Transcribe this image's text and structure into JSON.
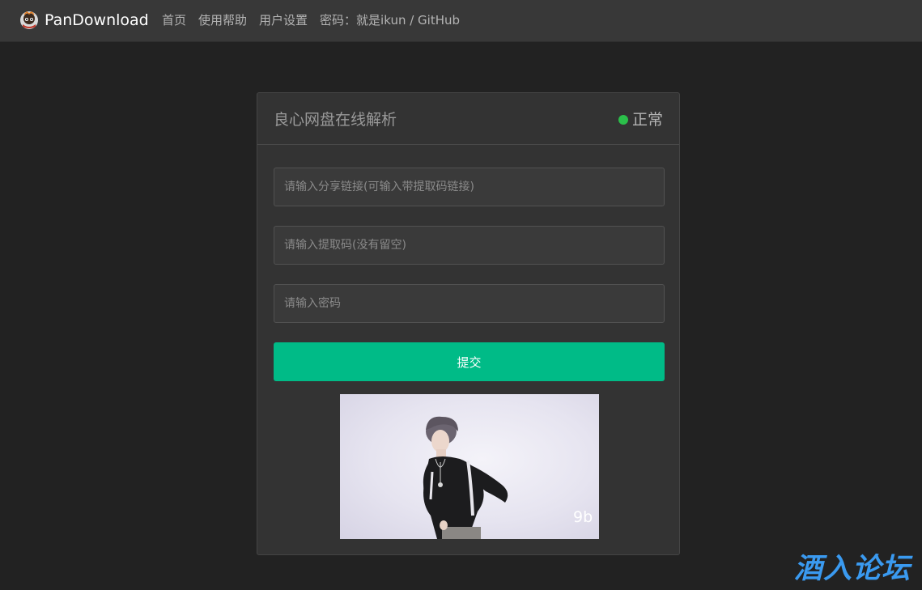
{
  "navbar": {
    "brand": "PanDownload",
    "links": [
      {
        "label": "首页"
      },
      {
        "label": "使用帮助"
      },
      {
        "label": "用户设置"
      },
      {
        "label": "密码：就是ikun / GitHub"
      }
    ]
  },
  "card": {
    "title": "良心网盘在线解析",
    "status": {
      "label": "正常",
      "color": "#2bbf4a"
    },
    "fields": {
      "share_link": {
        "value": "",
        "placeholder": "请输入分享链接(可输入带提取码链接)"
      },
      "extract_code": {
        "value": "",
        "placeholder": "请输入提取码(没有留空)"
      },
      "password": {
        "value": "",
        "placeholder": "请输入密码"
      }
    },
    "submit_label": "提交",
    "submit_color": "#00bb87"
  },
  "photo_watermark": "9b",
  "site_watermark": "酒入论坛"
}
